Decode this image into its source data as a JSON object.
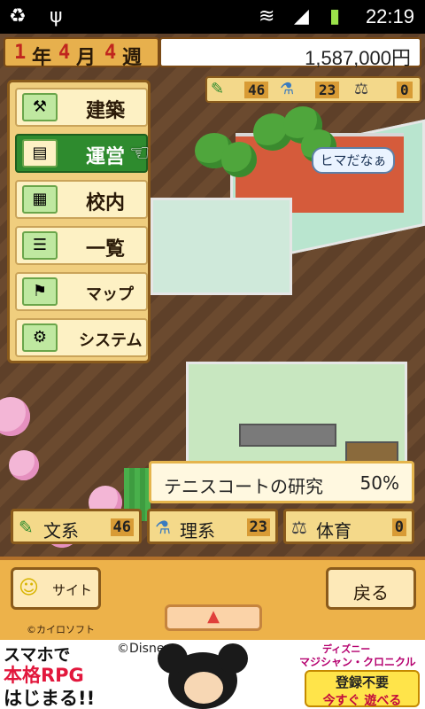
{
  "status_bar": {
    "time": "22:19",
    "icons": [
      "recycle-icon",
      "usb-icon",
      "wifi-icon",
      "signal-icon",
      "battery-charging-icon"
    ]
  },
  "date": {
    "year_num": "1",
    "year_unit": "年",
    "month_num": "4",
    "month_unit": "月",
    "week_num": "4",
    "week_unit": "週"
  },
  "money": "1,587,000円",
  "top_resources": [
    {
      "icon": "pencil-icon",
      "value": "46"
    },
    {
      "icon": "flask-icon",
      "value": "23"
    },
    {
      "icon": "weight-icon",
      "value": "0"
    }
  ],
  "menu": {
    "items": [
      {
        "label": "建築",
        "icon": "construction-icon"
      },
      {
        "label": "運営",
        "icon": "management-icon",
        "active": true
      },
      {
        "label": "校内",
        "icon": "school-icon"
      },
      {
        "label": "一覧",
        "icon": "list-icon"
      },
      {
        "label": "マップ",
        "icon": "map-icon"
      },
      {
        "label": "システム",
        "icon": "system-icon"
      }
    ]
  },
  "speech_bubble": "ヒマだなぁ",
  "research": {
    "title": "テニスコートの研究",
    "percent": "50%"
  },
  "stats": [
    {
      "icon": "pencil-icon",
      "label": "文系",
      "value": "46"
    },
    {
      "icon": "flask-icon",
      "label": "理系",
      "value": "23"
    },
    {
      "icon": "weight-icon",
      "label": "体育",
      "value": "0"
    }
  ],
  "bottom": {
    "site_label": "サイト",
    "back_label": "戻る",
    "copyright": "©カイロソフト"
  },
  "ad": {
    "line1": "スマホで",
    "line2": "本格RPG",
    "line3": "はじまる!!",
    "disney": "©Disney",
    "right_title_1": "ディズニー",
    "right_title_2": "マジシャン・クロニクル",
    "button_1": "登録不要",
    "button_2": "今すぐ 遊べる"
  },
  "colors": {
    "accent_green": "#2e8b2e",
    "panel_orange": "#edb24a",
    "wood_brown": "#8a5b1c"
  }
}
